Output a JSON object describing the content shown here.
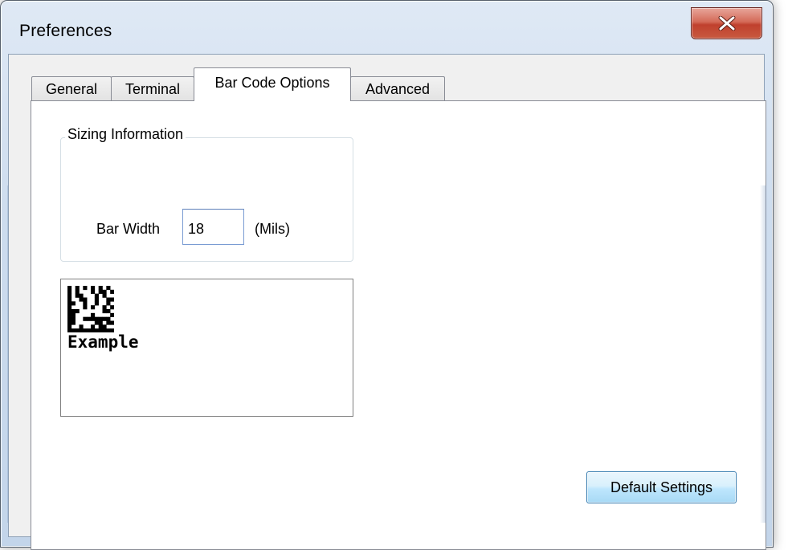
{
  "window": {
    "title": "Preferences",
    "close_icon": "close-icon"
  },
  "tabs": [
    {
      "label": "General",
      "active": false
    },
    {
      "label": "Terminal",
      "active": false
    },
    {
      "label": "Bar Code Options",
      "active": true
    },
    {
      "label": "Advanced",
      "active": false
    }
  ],
  "sizing": {
    "group_label": "Sizing Information",
    "bar_width_label": "Bar Width",
    "bar_width_value": "18",
    "units_label": "(Mils)"
  },
  "preview": {
    "example_text": "Example",
    "barcode_icon": "datamatrix-barcode-icon"
  },
  "buttons": {
    "default_settings": "Default Settings"
  },
  "colors": {
    "close_button": "#c7432f",
    "button_accent": "#3c7fb1"
  }
}
